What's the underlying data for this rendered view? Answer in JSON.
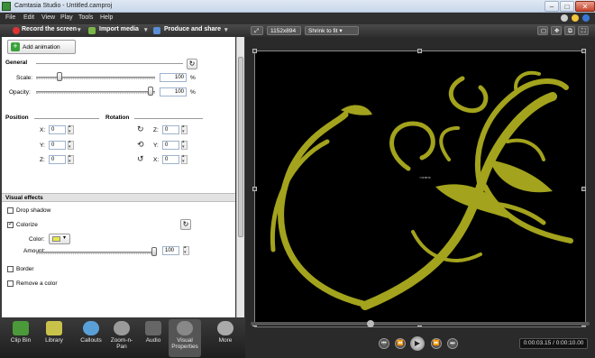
{
  "window": {
    "title": "Camtasia Studio - Untitled.camproj",
    "minimize": "–",
    "maximize": "□",
    "close": "✕"
  },
  "menu": {
    "items": [
      "File",
      "Edit",
      "View",
      "Play",
      "Tools",
      "Help"
    ]
  },
  "toolbar": {
    "record": "Record the screen",
    "import": "Import media",
    "produce": "Produce and share"
  },
  "properties": {
    "add_animation": "Add animation",
    "general": {
      "title": "General",
      "scale_label": "Scale:",
      "scale_value": "100",
      "scale_unit": "%",
      "opacity_label": "Opacity:",
      "opacity_value": "100",
      "opacity_unit": "%"
    },
    "position": {
      "title": "Position",
      "x_label": "X:",
      "x": "0",
      "y_label": "Y:",
      "y": "0",
      "z_label": "Z:",
      "z": "0"
    },
    "rotation": {
      "title": "Rotation",
      "z_label": "Z:",
      "z": "0",
      "y_label": "Y:",
      "y": "0",
      "x_label": "X:",
      "x": "0"
    },
    "visual_effects": {
      "title": "Visual effects",
      "drop_shadow": "Drop shadow",
      "colorize": "Colorize",
      "color_label": "Color:",
      "amount_label": "Amount:",
      "amount_value": "100",
      "border": "Border",
      "remove_color": "Remove a color"
    }
  },
  "tabs": [
    {
      "label": "Clip Bin",
      "color": "#4a9a3a"
    },
    {
      "label": "Library",
      "color": "#c9c24a"
    },
    {
      "label": "Callouts",
      "color": "#5aa0d8"
    },
    {
      "label": "Zoom-n-Pan",
      "color": "#9a9a9a"
    },
    {
      "label": "Audio",
      "color": "#666666"
    },
    {
      "label": "Visual Properties",
      "color": "#888888"
    },
    {
      "label": "More",
      "color": "#aaaaaa"
    }
  ],
  "preview": {
    "dimensions": "1152x894",
    "zoom": "Shrink to fit",
    "timecode": "0:00:03.15 / 0:00:10.00",
    "playback_fraction": 0.35
  },
  "colors": {
    "flourish": "#a3a31d",
    "canvas": "#000000",
    "accent_green": "#3d8e3a"
  }
}
